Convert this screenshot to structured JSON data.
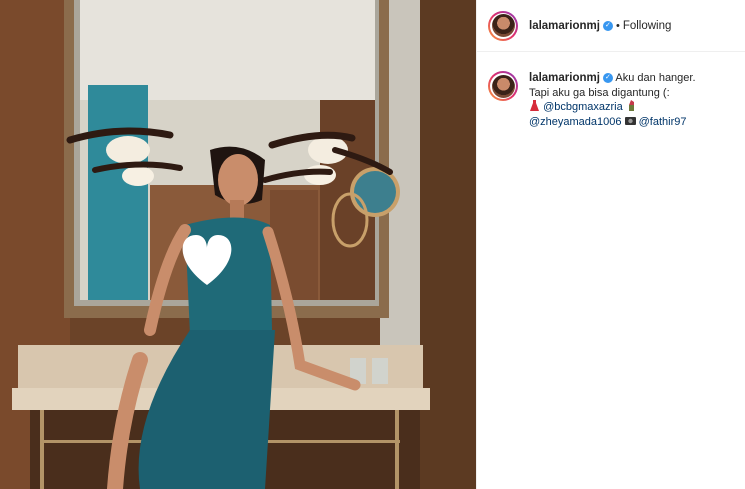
{
  "post": {
    "username": "lalamarionmj",
    "verified_icon": "verified-badge-icon",
    "separator": "•",
    "follow_status": "Following"
  },
  "caption": {
    "username": "lalamarionmj",
    "line1": "Aku dan hanger.",
    "line2": "Tapi aku ga bisa digantung (:",
    "mention1": "@bcbgmaxazria",
    "mention2": "@zheyamada1006",
    "mention3": "@fathir97",
    "emoji1": "dress-emoji",
    "emoji2": "lipstick-emoji",
    "emoji3": "camera-emoji"
  },
  "colors": {
    "accent": "#3897f0",
    "mention": "#003569",
    "dress": "#1f6a78"
  }
}
